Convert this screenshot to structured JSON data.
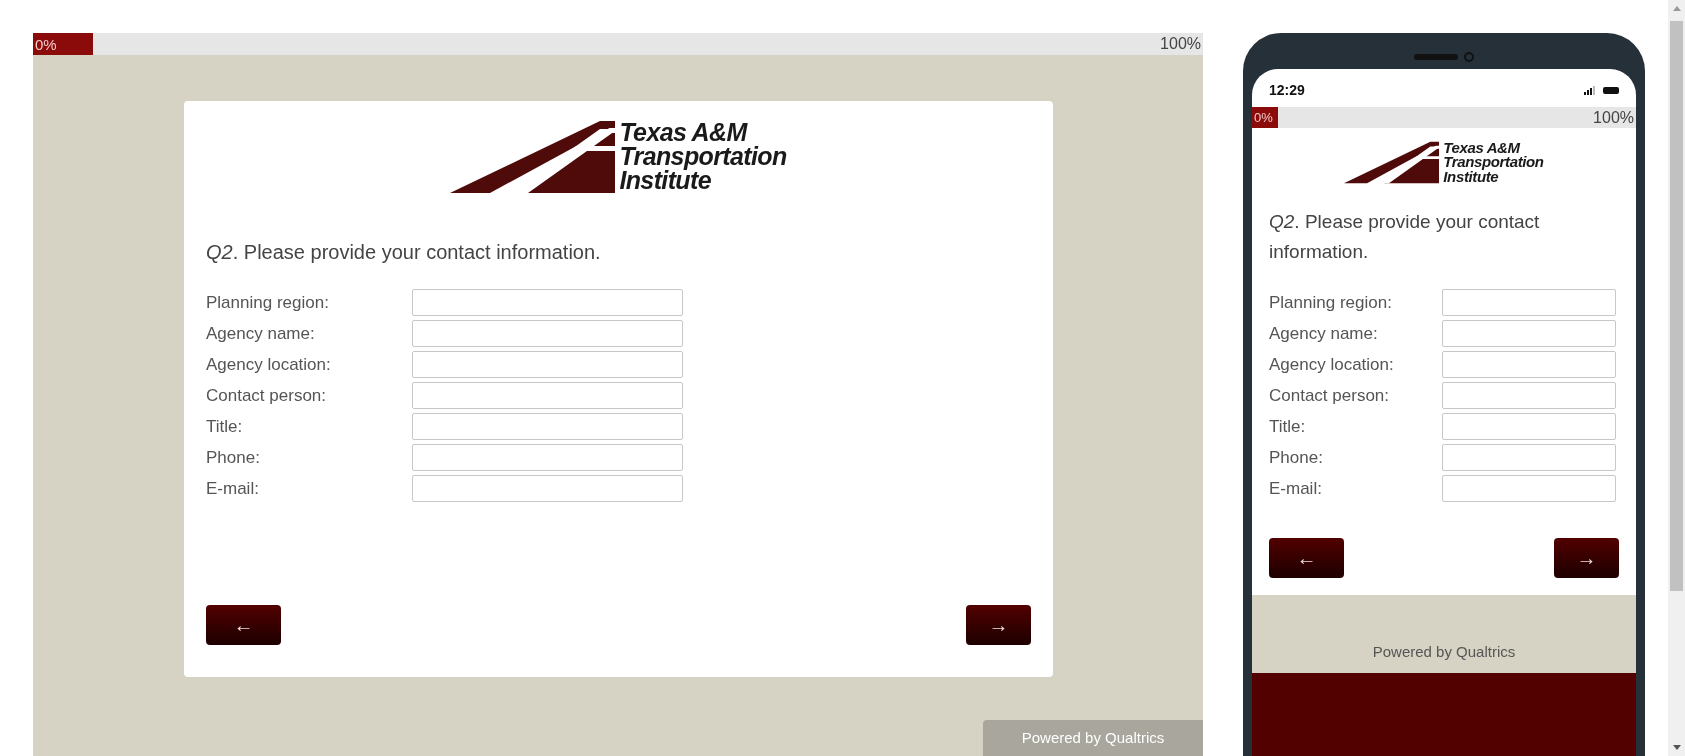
{
  "desktop": {
    "progress": {
      "level": 0,
      "start_label": "0%",
      "end_label": "100%"
    },
    "logo": {
      "lines": [
        "Texas A&M",
        "Transportation",
        "Institute"
      ]
    },
    "question": "*Q2*. Please provide your contact information.",
    "fields": [
      {
        "label": "Planning region:"
      },
      {
        "label": "Agency name:"
      },
      {
        "label": "Agency location:"
      },
      {
        "label": "Contact person:"
      },
      {
        "label": "Title:"
      },
      {
        "label": "Phone:"
      },
      {
        "label": "E-mail:"
      }
    ],
    "back_button": "←",
    "next_button": "→",
    "footer": "Powered by Qualtrics"
  },
  "phone": {
    "status_time": "12:29",
    "progress": {
      "level": 0,
      "start_label": "0%",
      "end_label": "100%"
    },
    "logo": {
      "lines": [
        "Texas A&M",
        "Transportation",
        "Institute"
      ]
    },
    "question": "*Q2*. Please provide your contact information.",
    "fields": [
      {
        "label": "Planning region:"
      },
      {
        "label": "Agency name:"
      },
      {
        "label": "Agency location:"
      },
      {
        "label": "Contact person:"
      },
      {
        "label": "Title:"
      },
      {
        "label": "Phone:"
      },
      {
        "label": "E-mail:"
      }
    ],
    "back_button": "←",
    "next_button": "→",
    "footer": "Powered by Qualtrics"
  }
}
